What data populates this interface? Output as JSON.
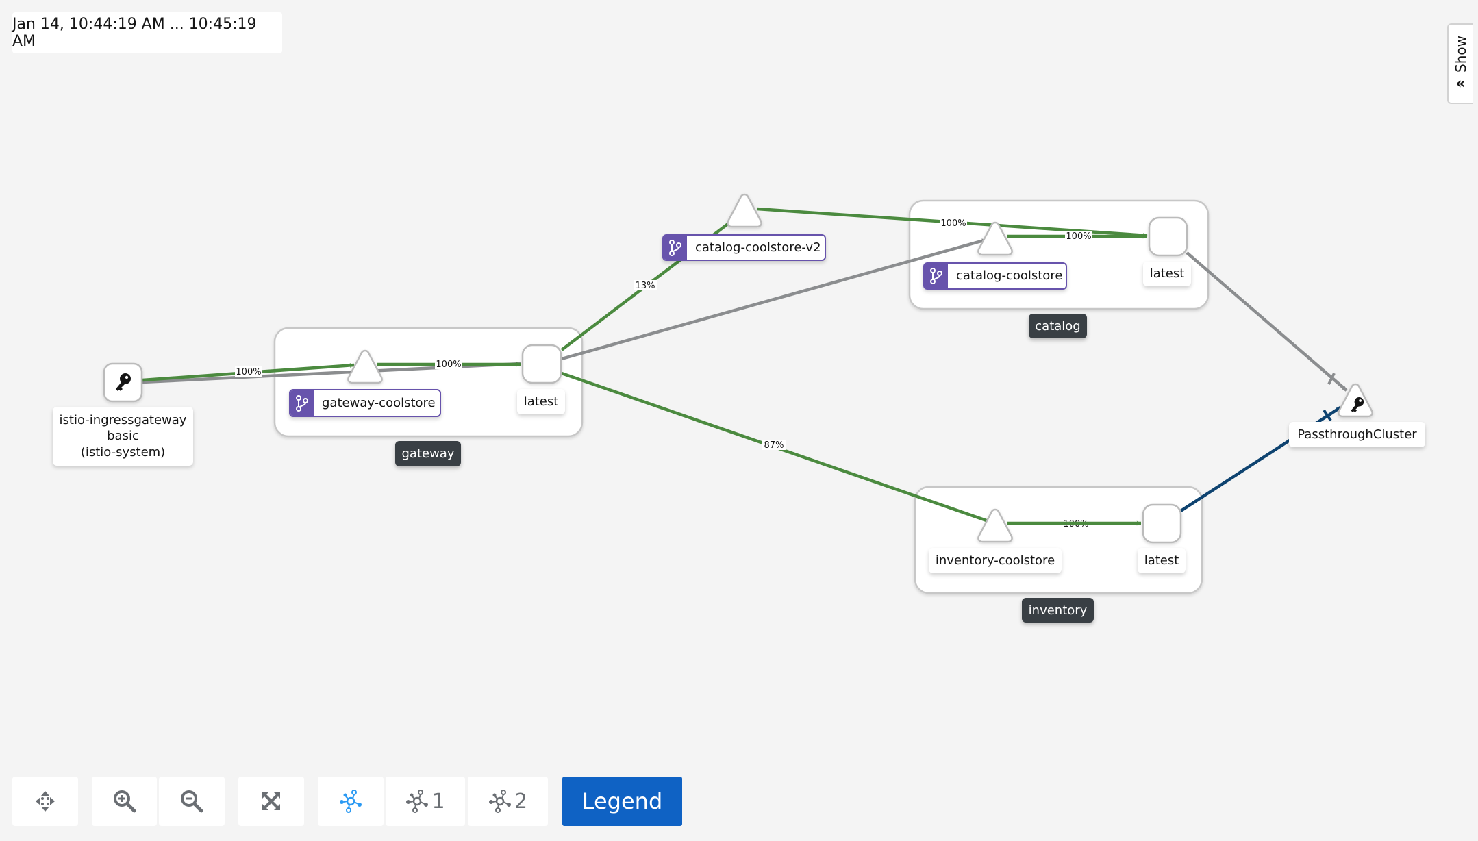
{
  "time_range": "Jan 14, 10:44:19 AM ... 10:45:19 AM",
  "side_panel": {
    "toggle_label": "Show",
    "icon": "double-chevron-left-icon"
  },
  "colors": {
    "edge_ok": "#4b8a3f",
    "edge_idle": "#8b8d8f",
    "edge_tcp": "#0e4370",
    "badge": "#6753ac",
    "group_label_bg": "#393f44",
    "legend_button": "#0f62c4",
    "active_layout": "#2b9af3"
  },
  "graph": {
    "groups": [
      {
        "id": "gateway",
        "label": "gateway"
      },
      {
        "id": "catalog",
        "label": "catalog"
      },
      {
        "id": "inventory",
        "label": "inventory"
      }
    ],
    "nodes": [
      {
        "id": "ingress",
        "type": "workload-root",
        "shape": "square",
        "icon": "key-icon",
        "label_lines": [
          "istio-ingressgateway",
          "basic",
          "(istio-system)"
        ]
      },
      {
        "id": "gw-svc",
        "type": "service",
        "shape": "triangle",
        "label": "gateway-coolstore",
        "badge": "virtual-service-icon",
        "group": "gateway"
      },
      {
        "id": "gw-latest",
        "type": "app-version",
        "shape": "square",
        "label": "latest",
        "group": "gateway"
      },
      {
        "id": "cat-v2-svc",
        "type": "service",
        "shape": "triangle",
        "label": "catalog-coolstore-v2",
        "badge": "virtual-service-icon"
      },
      {
        "id": "cat-svc",
        "type": "service",
        "shape": "triangle",
        "label": "catalog-coolstore",
        "badge": "virtual-service-icon",
        "group": "catalog"
      },
      {
        "id": "cat-latest",
        "type": "app-version",
        "shape": "square",
        "label": "latest",
        "group": "catalog"
      },
      {
        "id": "inv-svc",
        "type": "service",
        "shape": "triangle",
        "label": "inventory-coolstore",
        "group": "inventory"
      },
      {
        "id": "inv-latest",
        "type": "app-version",
        "shape": "square",
        "label": "latest",
        "group": "inventory"
      },
      {
        "id": "passthrough",
        "type": "service-entry",
        "shape": "triangle",
        "icon": "key-icon",
        "label": "PassthroughCluster"
      }
    ],
    "edges": [
      {
        "from": "ingress",
        "to": "gw-svc",
        "label": "100%",
        "status": "ok"
      },
      {
        "from": "ingress",
        "to": "gw-latest",
        "label": "",
        "status": "idle"
      },
      {
        "from": "gw-svc",
        "to": "gw-latest",
        "label": "100%",
        "status": "ok"
      },
      {
        "from": "gw-latest",
        "to": "cat-v2-svc",
        "label": "13%",
        "status": "ok"
      },
      {
        "from": "gw-latest",
        "to": "cat-svc",
        "label": "",
        "status": "idle"
      },
      {
        "from": "gw-latest",
        "to": "inv-svc",
        "label": "87%",
        "status": "ok"
      },
      {
        "from": "cat-v2-svc",
        "to": "cat-latest",
        "label": "100%",
        "status": "ok"
      },
      {
        "from": "cat-svc",
        "to": "cat-latest",
        "label": "100%",
        "status": "ok"
      },
      {
        "from": "cat-latest",
        "to": "passthrough",
        "label": "",
        "status": "idle",
        "protocol": "tcp"
      },
      {
        "from": "inv-latest",
        "to": "passthrough",
        "label": "",
        "status": "tcp",
        "protocol": "tcp"
      }
    ]
  },
  "toolbar": {
    "pan": {
      "icon": "pan-icon"
    },
    "zoom_in": {
      "icon": "zoom-in-icon"
    },
    "zoom_out": {
      "icon": "zoom-out-icon"
    },
    "fit": {
      "icon": "expand-icon"
    },
    "layout_default": {
      "icon": "topology-icon",
      "label": ""
    },
    "layout_1": {
      "icon": "topology-icon",
      "label": "1"
    },
    "layout_2": {
      "icon": "topology-icon",
      "label": "2"
    },
    "legend_label": "Legend"
  }
}
